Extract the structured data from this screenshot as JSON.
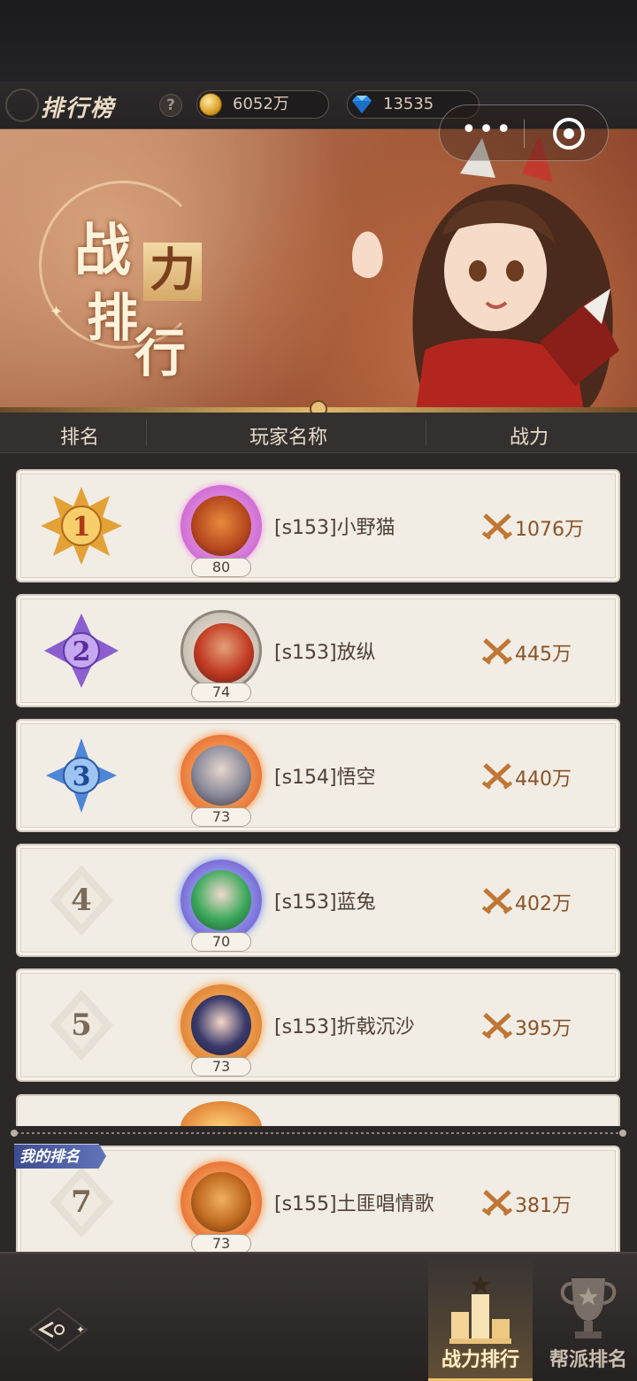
{
  "header": {
    "title": "排行榜",
    "help_icon": "question-icon",
    "gold": "6052万",
    "diamonds": "13535"
  },
  "banner": {
    "chars": [
      "战",
      "排",
      "力",
      "行"
    ]
  },
  "columns": {
    "rank": "排名",
    "player": "玩家名称",
    "power": "战力"
  },
  "rows": [
    {
      "rank": "1",
      "name": "[s153]小野猫",
      "level": "80",
      "power": "1076万"
    },
    {
      "rank": "2",
      "name": "[s153]放纵",
      "level": "74",
      "power": "445万"
    },
    {
      "rank": "3",
      "name": "[s154]悟空",
      "level": "73",
      "power": "440万"
    },
    {
      "rank": "4",
      "name": "[s153]蓝兔",
      "level": "70",
      "power": "402万"
    },
    {
      "rank": "5",
      "name": "[s153]折戟沉沙",
      "level": "73",
      "power": "395万"
    }
  ],
  "my_rank": {
    "tag": "我的排名",
    "rank": "7",
    "name": "[s155]土匪唱情歌",
    "level": "73",
    "power": "381万"
  },
  "nav": {
    "tabs": [
      {
        "label": "战力排行",
        "icon": "podium-icon",
        "active": true
      },
      {
        "label": "帮派排名",
        "icon": "trophy-icon",
        "active": false
      }
    ]
  },
  "colors": {
    "gold_badge": "#e3a136",
    "purple_badge": "#8b5fd0",
    "blue_badge": "#4f86d6",
    "power_text": "#8a5226",
    "active_tab": "#f2c06e"
  }
}
